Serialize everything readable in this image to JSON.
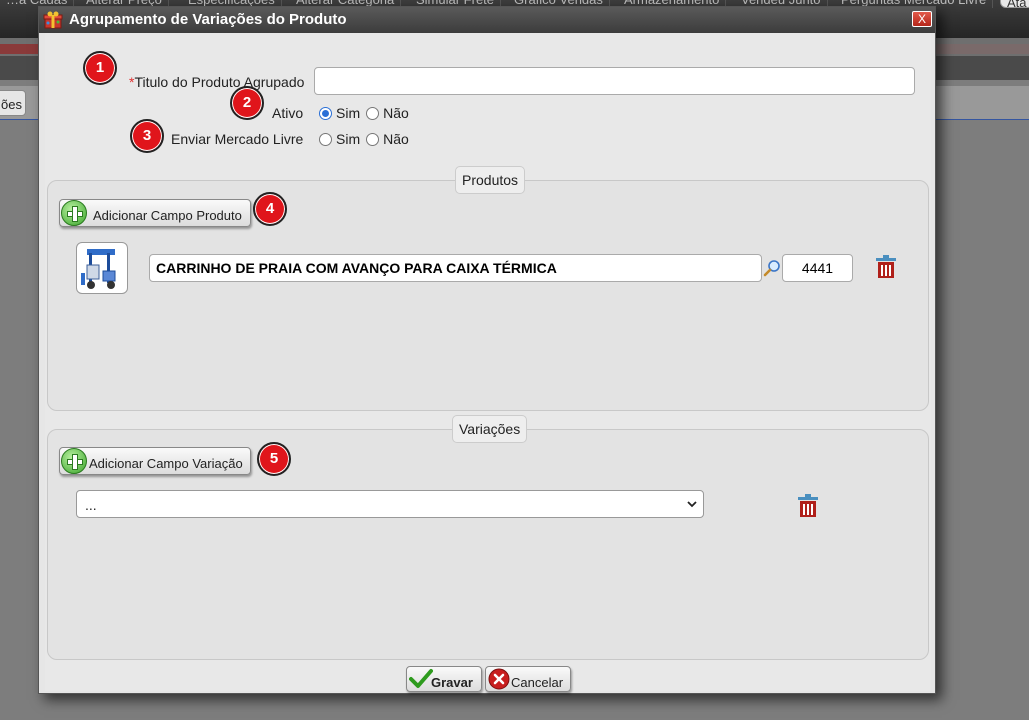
{
  "background": {
    "tabs": [
      "…a Cadas",
      "Alterar Preço",
      "Especificações",
      "Alterar Categoria",
      "Simular Frete",
      "Gráfico Vendas",
      "Armazenamento",
      "Vendeu Junto",
      "Perguntas Mercado Livre",
      "Ata"
    ],
    "side_button_label": "ões"
  },
  "dialog": {
    "title": "Agrupamento de Variações do Produto",
    "close_label": "X"
  },
  "form": {
    "title_field": {
      "badge": "1",
      "required_mark": "*",
      "label": "Titulo do Produto Agrupado",
      "value": ""
    },
    "ativo": {
      "badge": "2",
      "label": "Ativo",
      "options": [
        "Sim",
        "Não"
      ],
      "selected": "Sim"
    },
    "mercado_livre": {
      "badge": "3",
      "label": "Enviar Mercado Livre",
      "options": [
        "Sim",
        "Não"
      ],
      "selected": ""
    }
  },
  "produtos": {
    "legend": "Produtos",
    "add_button": "Adicionar Campo Produto",
    "badge": "4",
    "items": [
      {
        "name": "CARRINHO DE PRAIA COM AVANÇO PARA CAIXA TÉRMICA",
        "code": "4441"
      }
    ]
  },
  "variacoes": {
    "legend": "Variações",
    "add_button": "Adicionar Campo Variação",
    "badge": "5",
    "select_value": "..."
  },
  "footer": {
    "save_label": "Gravar",
    "cancel_label": "Cancelar"
  },
  "colors": {
    "badge_red": "#e0151b",
    "radio_blue": "#2a6fd6",
    "trash_red": "#b0201a"
  }
}
